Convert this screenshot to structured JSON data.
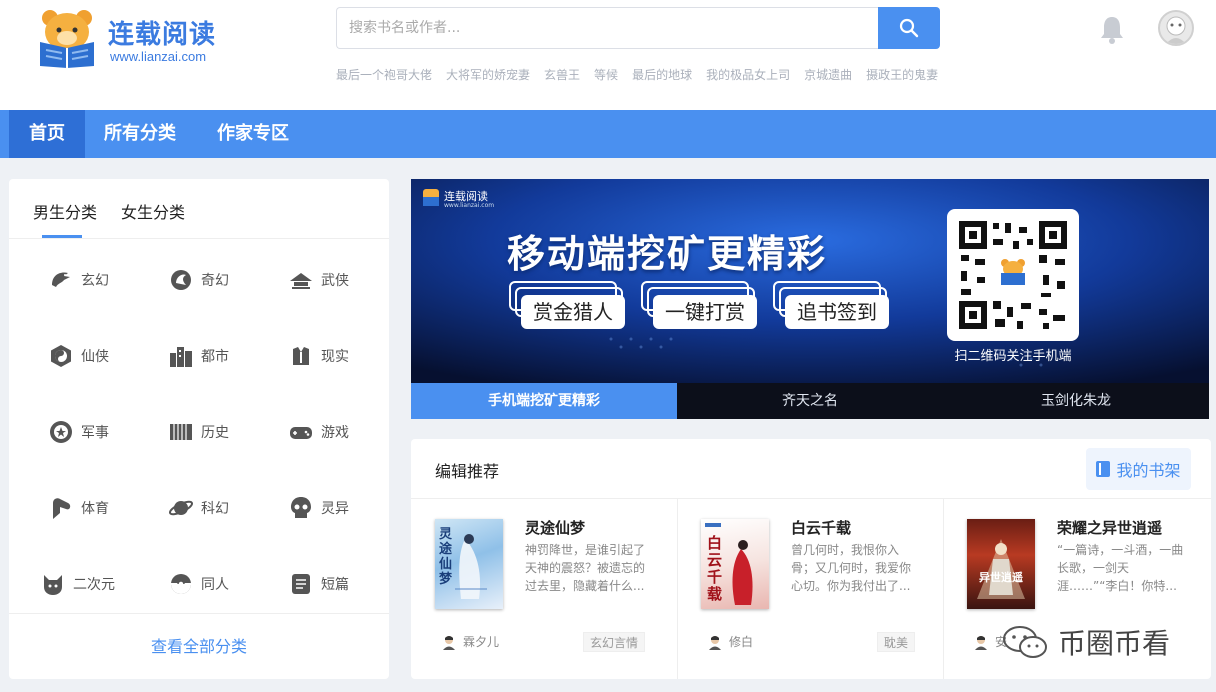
{
  "brand": {
    "name": "连载阅读",
    "url": "www.lianzai.com"
  },
  "search": {
    "placeholder": "搜索书名或作者...",
    "hot": [
      "最后一个袍哥大佬",
      "大将军的娇宠妻",
      "玄兽王",
      "等候",
      "最后的地球",
      "我的极品女上司",
      "京城遗曲",
      "摄政王的鬼妻"
    ]
  },
  "nav": {
    "items": [
      "首页",
      "所有分类",
      "作家专区"
    ]
  },
  "categories": {
    "tabs": [
      "男生分类",
      "女生分类"
    ],
    "items": [
      {
        "label": "玄幻",
        "icon": "dragon-icon"
      },
      {
        "label": "奇幻",
        "icon": "griffin-icon"
      },
      {
        "label": "武侠",
        "icon": "hat-icon"
      },
      {
        "label": "仙侠",
        "icon": "yin-yang-icon"
      },
      {
        "label": "都市",
        "icon": "city-icon"
      },
      {
        "label": "现实",
        "icon": "suit-icon"
      },
      {
        "label": "军事",
        "icon": "badge-icon"
      },
      {
        "label": "历史",
        "icon": "scroll-icon"
      },
      {
        "label": "游戏",
        "icon": "gamepad-icon"
      },
      {
        "label": "体育",
        "icon": "muscle-icon"
      },
      {
        "label": "科幻",
        "icon": "planet-icon"
      },
      {
        "label": "灵异",
        "icon": "skull-icon"
      },
      {
        "label": "二次元",
        "icon": "cat-icon"
      },
      {
        "label": "同人",
        "icon": "pokeball-icon"
      },
      {
        "label": "短篇",
        "icon": "document-icon"
      }
    ],
    "view_all": "查看全部分类"
  },
  "banner": {
    "logo_name": "连载阅读",
    "logo_url": "www.lianzai.com",
    "headline": "移动端挖矿更精彩",
    "features": [
      "赏金猎人",
      "一键打赏",
      "追书签到"
    ],
    "qr_caption": "扫二维码关注手机端",
    "tabs": [
      "手机端挖矿更精彩",
      "齐天之名",
      "玉剑化朱龙"
    ]
  },
  "recommend": {
    "title": "编辑推荐",
    "shelf_label": "我的书架",
    "books": [
      {
        "name": "灵途仙梦",
        "desc": "神罚降世，是谁引起了天神的震怒？被遗忘的过去里，隐藏着什么...",
        "author": "霖夕儿",
        "tag": "玄幻言情",
        "cover_text": "灵途仙梦"
      },
      {
        "name": "白云千载",
        "desc": "曾几何时，我恨你入骨；又几何时，我爱你心切。你为我付出了...",
        "author": "修白",
        "tag": "耽美",
        "cover_text": "白云千载"
      },
      {
        "name": "荣耀之异世逍遥",
        "desc": "“一篇诗，一斗酒，一曲长歌，一剑天涯……”“李白！你特...",
        "author": "安",
        "tag": "",
        "cover_text": "异世逍遥"
      }
    ]
  },
  "watermark": "币圈币看"
}
